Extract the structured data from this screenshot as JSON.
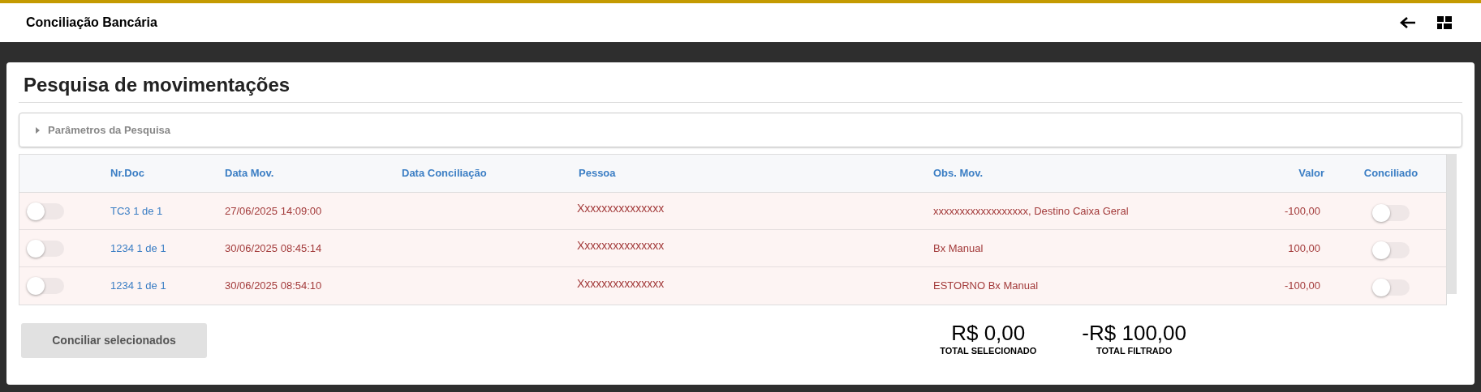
{
  "header": {
    "title": "Conciliação Bancária"
  },
  "page": {
    "title": "Pesquisa de movimentações"
  },
  "search_params": {
    "label": "Parâmetros da Pesquisa",
    "expanded": false
  },
  "table": {
    "columns": [
      "Nr.Doc",
      "Data Mov.",
      "Data Conciliação",
      "Pessoa",
      "Obs. Mov.",
      "Valor",
      "Conciliado"
    ],
    "rows": [
      {
        "selected": false,
        "nr_doc": "TC3 1 de 1",
        "data_mov": "27/06/2025 14:09:00",
        "data_conciliacao": "",
        "pessoa": "Xxxxxxxxxxxxxxx",
        "obs": "xxxxxxxxxxxxxxxxxx, Destino Caixa Geral",
        "valor": "-100,00",
        "conciliado": false
      },
      {
        "selected": false,
        "nr_doc": "1234 1 de 1",
        "data_mov": "30/06/2025 08:45:14",
        "data_conciliacao": "",
        "pessoa": "Xxxxxxxxxxxxxxx",
        "obs": "Bx Manual",
        "valor": "100,00",
        "conciliado": false
      },
      {
        "selected": false,
        "nr_doc": "1234 1 de 1",
        "data_mov": "30/06/2025 08:54:10",
        "data_conciliacao": "",
        "pessoa": "Xxxxxxxxxxxxxxx",
        "obs": "ESTORNO Bx Manual",
        "valor": "-100,00",
        "conciliado": false
      }
    ]
  },
  "footer": {
    "button": "Conciliar selecionados",
    "totals": [
      {
        "value": "R$ 0,00",
        "label": "TOTAL SELECIONADO"
      },
      {
        "value": "-R$ 100,00",
        "label": "TOTAL FILTRADO"
      }
    ]
  }
}
